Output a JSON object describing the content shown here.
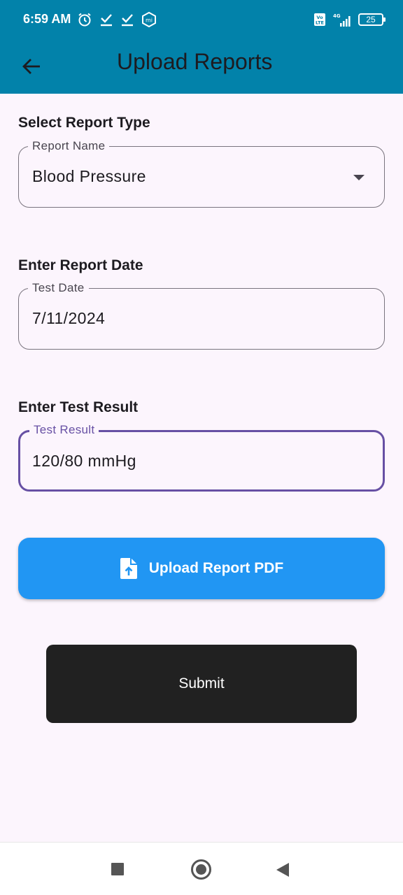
{
  "status_bar": {
    "time": "6:59 AM",
    "left_icons": [
      "alarm-icon",
      "check-icon",
      "check-icon",
      "mi-icon"
    ],
    "network_label": "4G",
    "volte_label": "Vo LTE",
    "battery": "25"
  },
  "app_bar": {
    "title": "Upload Reports",
    "back_icon": "arrow-left-icon",
    "background": "#0282aa"
  },
  "form": {
    "report_type": {
      "section_label": "Select Report Type",
      "legend": "Report Name",
      "value": "Blood Pressure"
    },
    "report_date": {
      "section_label": "Enter Report Date",
      "legend": "Test Date",
      "value": "7/11/2024"
    },
    "test_result": {
      "section_label": "Enter Test Result",
      "legend": "Test Result",
      "value": "120/80 mmHg",
      "focused_color": "#6750a4"
    }
  },
  "upload_button": {
    "label": "Upload Report PDF",
    "icon": "file-upload-icon",
    "color": "#2196f3"
  },
  "submit_button": {
    "label": "Submit",
    "color": "#212121"
  },
  "nav_bar": {
    "icons": [
      "recents-icon",
      "home-icon",
      "back-icon"
    ]
  }
}
